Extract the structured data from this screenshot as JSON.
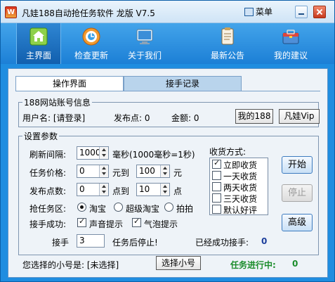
{
  "window": {
    "title": "凡娃188自动抢任务软件  龙版 V7.5",
    "menu_label": "菜单"
  },
  "toolbar": [
    {
      "label": "主界面",
      "icon": "home-icon",
      "active": true
    },
    {
      "label": "检查更新",
      "icon": "update-icon",
      "active": false
    },
    {
      "label": "关于我们",
      "icon": "monitor-icon",
      "active": false
    },
    {
      "label": "最新公告",
      "icon": "clipboard-icon",
      "active": false
    },
    {
      "label": "我的建议",
      "icon": "toolbox-icon",
      "active": false
    }
  ],
  "tabs": [
    {
      "label": "操作界面",
      "active": true
    },
    {
      "label": "接手记录",
      "active": false
    }
  ],
  "account": {
    "legend": "188网站账号信息",
    "username_label": "用户名: [请登录]",
    "points_label": "发布点: 0",
    "balance_label": "金额: 0",
    "my188_button": "我的188",
    "vip_button": "凡娃Vip"
  },
  "settings": {
    "legend": "设置参数",
    "interval_label": "刷新间隔:",
    "interval_value": "1000",
    "interval_unit": "毫秒(1000毫秒=1秒)",
    "price_label": "任务价格:",
    "price_min": "0",
    "price_to": "元到",
    "price_max": "100",
    "price_unit": "元",
    "points_label": "发布点数:",
    "points_min": "0",
    "points_to": "点到",
    "points_max": "10",
    "points_unit": "点",
    "zone_label": "抢任务区:",
    "zones": [
      {
        "label": "淘宝",
        "checked": true
      },
      {
        "label": "超级淘宝",
        "checked": false
      },
      {
        "label": "拍拍",
        "checked": false
      }
    ],
    "success_label": "接手成功:",
    "sound_label": "声音提示",
    "sound_checked": true,
    "bubble_label": "气泡提示",
    "bubble_checked": true,
    "stop_prefix": "接手",
    "stop_value": "3",
    "stop_suffix": "任务后停止!",
    "success_count_label": "已经成功接手:",
    "success_count": "0",
    "receive_label": "收货方式:",
    "receive_options": [
      {
        "label": "立即收货",
        "checked": true
      },
      {
        "label": "一天收货",
        "checked": false
      },
      {
        "label": "两天收货",
        "checked": false
      },
      {
        "label": "三天收货",
        "checked": false
      },
      {
        "label": "默认好评",
        "checked": false
      }
    ]
  },
  "actions": {
    "start": "开始",
    "stop": "停止",
    "advanced": "高级"
  },
  "footer": {
    "selected_label": "您选择的小号是: [未选择]",
    "select_button": "选择小号",
    "status_label": "任务进行中:",
    "status_value": "0"
  },
  "colors": {
    "accent": "#1f8de0",
    "status_green": "#1a8c2a"
  }
}
